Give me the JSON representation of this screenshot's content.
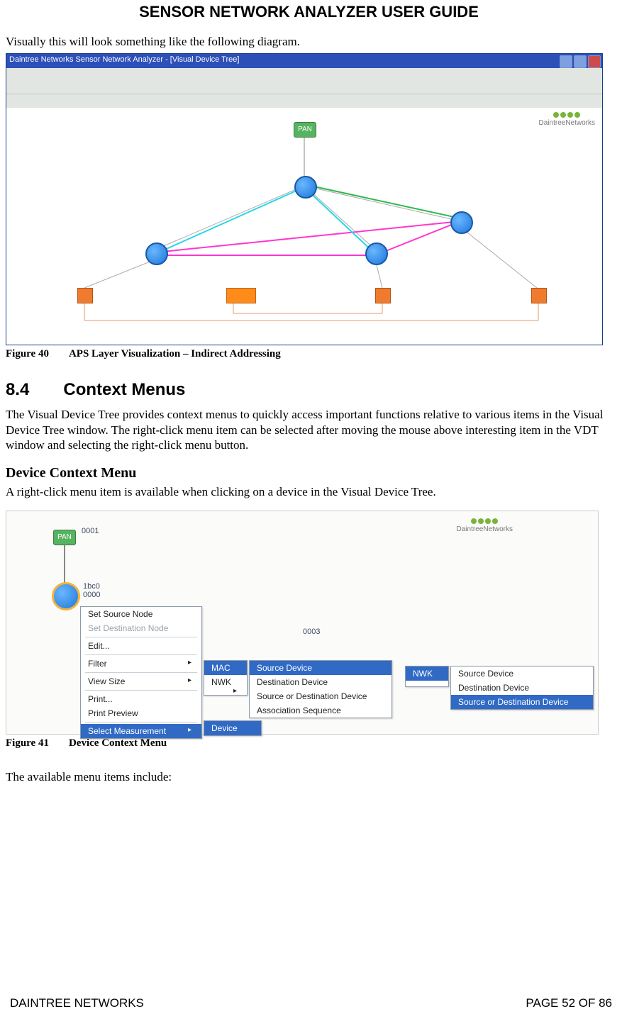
{
  "doc": {
    "title": "SENSOR NETWORK ANALYZER USER GUIDE",
    "intro40": "Visually this will look something like the following diagram.",
    "fig40num": "Figure 40",
    "fig40cap": "APS Layer Visualization – Indirect Addressing",
    "sec_num": "8.4",
    "sec_title": "Context Menus",
    "sec_body": "The Visual Device Tree provides context menus to quickly access important functions relative to various items in the Visual Device Tree window. The right-click menu item can be selected after moving the mouse above interesting item in the VDT window and selecting the right-click menu button.",
    "sub_title": "Device Context Menu",
    "sub_body": "A right-click menu item is available when clicking on a device in the Visual Device Tree.",
    "fig41num": "Figure 41",
    "fig41cap": "Device Context Menu",
    "after41": "The available menu items include:",
    "footer_left": "DAINTREE NETWORKS",
    "footer_right": "PAGE 52 OF 86"
  },
  "app1": {
    "title": "Daintree Networks Sensor Network Analyzer - [Visual Device Tree]",
    "logo": "DaintreeNetworks",
    "pan_label": "PAN"
  },
  "app2": {
    "logo": "DaintreeNetworks",
    "pan_label": "PAN",
    "node_sel": "1bc0\n0000",
    "node_sel_top": "0001",
    "far_label": "0003",
    "menu_items": {
      "set_src": "Set Source Node",
      "set_dst": "Set Destination Node",
      "edit": "Edit...",
      "filter": "Filter",
      "view_size": "View Size",
      "print": "Print...",
      "print_preview": "Print Preview",
      "sel_meas": "Select Measurement",
      "mac": "MAC",
      "nwk": "NWK",
      "src_dev": "Source Device",
      "dst_dev": "Destination Device",
      "src_or_dst": "Source or Destination Device",
      "assoc_seq": "Association Sequence",
      "device": "Device"
    }
  }
}
